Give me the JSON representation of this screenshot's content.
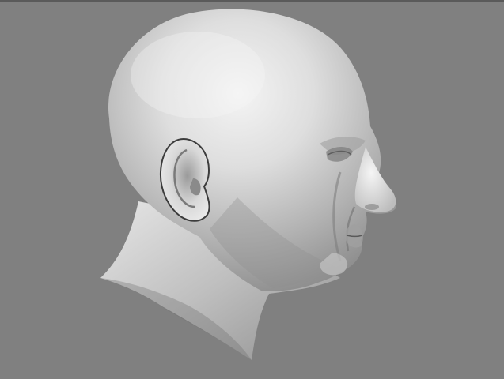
{
  "viewport": {
    "background_color": "#808080",
    "object": "3d-head-model",
    "shading": "smooth-gray",
    "view": "side-profile-right"
  },
  "colors": {
    "skin_light": "#f2f2f2",
    "skin_mid": "#bdbdbd",
    "skin_dark": "#6a6a6a",
    "edge_dark": "#3c3c3c",
    "top_border": "#5a5a5a"
  }
}
